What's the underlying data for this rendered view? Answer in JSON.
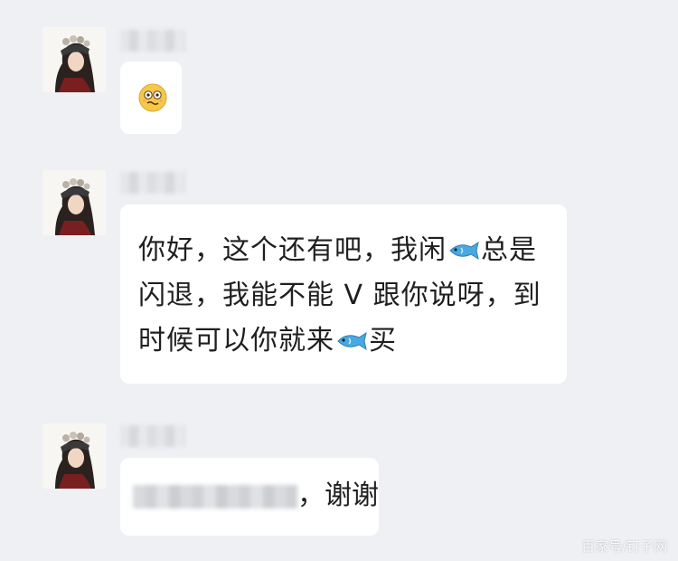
{
  "colors": {
    "background": "#eef0f4",
    "bubble": "#ffffff",
    "text": "#1f1f1f"
  },
  "messages": [
    {
      "sender_name": "",
      "content_type": "emoji",
      "emoji_icon": "shocked-face-icon"
    },
    {
      "sender_name": "",
      "content_type": "text",
      "segment_1": "你好，这个还有吧，我闲",
      "fish_icon_1": "fish-icon",
      "segment_2": "总是闪退，我能不能 V 跟你说呀，到时候可以你就来",
      "fish_icon_2": "fish-icon",
      "segment_3": "买"
    },
    {
      "sender_name": "",
      "content_type": "text",
      "suffix": "，谢谢"
    }
  ],
  "watermark": "百家号/钉子网"
}
